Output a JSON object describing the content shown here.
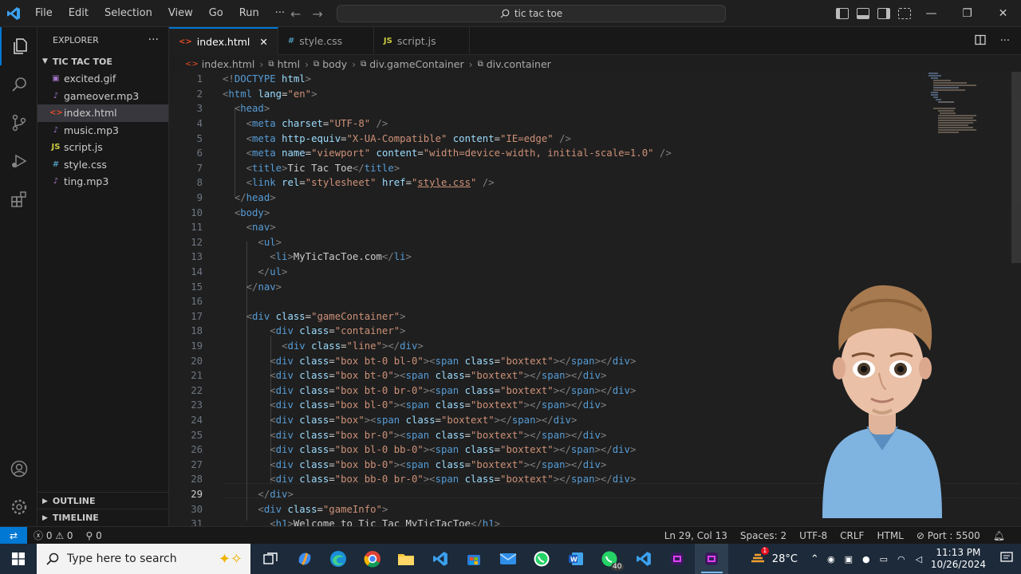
{
  "menu": [
    "File",
    "Edit",
    "Selection",
    "View",
    "Go",
    "Run",
    "···"
  ],
  "search": {
    "text": "tic tac toe"
  },
  "sidebar": {
    "title": "EXPLORER",
    "folder": "TIC TAC TOE",
    "files": [
      {
        "name": "excited.gif",
        "icon": "image-icon",
        "color": "#a074c4"
      },
      {
        "name": "gameover.mp3",
        "icon": "audio-icon",
        "color": "#a074c4"
      },
      {
        "name": "index.html",
        "icon": "html-icon",
        "color": "#e44d26"
      },
      {
        "name": "music.mp3",
        "icon": "audio-icon",
        "color": "#a074c4"
      },
      {
        "name": "script.js",
        "icon": "js-icon",
        "color": "#cbcb41"
      },
      {
        "name": "style.css",
        "icon": "css-icon",
        "color": "#519aba"
      },
      {
        "name": "ting.mp3",
        "icon": "audio-icon",
        "color": "#a074c4"
      }
    ],
    "outline": "OUTLINE",
    "timeline": "TIMELINE"
  },
  "tabs": [
    {
      "label": "index.html",
      "glyph": "<>",
      "color": "#e44d26",
      "active": true
    },
    {
      "label": "style.css",
      "glyph": "#",
      "color": "#519aba",
      "active": false
    },
    {
      "label": "script.js",
      "glyph": "JS",
      "color": "#cbcb41",
      "active": false
    }
  ],
  "breadcrumb": [
    "index.html",
    "html",
    "body",
    "div.gameContainer",
    "div.container"
  ],
  "code": [
    {
      "n": "1",
      "html": "<span class='t'>&lt;!</span><span class='tg'>DOCTYPE</span> <span class='at'>html</span><span class='t'>&gt;</span>"
    },
    {
      "n": "2",
      "html": "<span class='t'>&lt;</span><span class='tg'>html</span> <span class='at'>lang</span><span class='tx'>=</span><span class='st'>\"en\"</span><span class='t'>&gt;</span>"
    },
    {
      "n": "3",
      "html": "  <span class='t'>&lt;</span><span class='tg'>head</span><span class='t'>&gt;</span>"
    },
    {
      "n": "4",
      "html": "    <span class='t'>&lt;</span><span class='tg'>meta</span> <span class='at'>charset</span><span class='tx'>=</span><span class='st'>\"UTF-8\"</span> <span class='t'>/&gt;</span>"
    },
    {
      "n": "5",
      "html": "    <span class='t'>&lt;</span><span class='tg'>meta</span> <span class='at'>http-equiv</span><span class='tx'>=</span><span class='st'>\"X-UA-Compatible\"</span> <span class='at'>content</span><span class='tx'>=</span><span class='st'>\"IE=edge\"</span> <span class='t'>/&gt;</span>"
    },
    {
      "n": "6",
      "html": "    <span class='t'>&lt;</span><span class='tg'>meta</span> <span class='at'>name</span><span class='tx'>=</span><span class='st'>\"viewport\"</span> <span class='at'>content</span><span class='tx'>=</span><span class='st'>\"width=device-width, initial-scale=1.0\"</span> <span class='t'>/&gt;</span>"
    },
    {
      "n": "7",
      "html": "    <span class='t'>&lt;</span><span class='tg'>title</span><span class='t'>&gt;</span><span class='tx'>Tic Tac Toe</span><span class='t'>&lt;/</span><span class='tg'>title</span><span class='t'>&gt;</span>"
    },
    {
      "n": "8",
      "html": "    <span class='t'>&lt;</span><span class='tg'>link</span> <span class='at'>rel</span><span class='tx'>=</span><span class='st'>\"stylesheet\"</span> <span class='at'>href</span><span class='tx'>=</span><span class='st'>\"<u>style.css</u>\"</span> <span class='t'>/&gt;</span>"
    },
    {
      "n": "9",
      "html": "  <span class='t'>&lt;/</span><span class='tg'>head</span><span class='t'>&gt;</span>"
    },
    {
      "n": "10",
      "html": "  <span class='t'>&lt;</span><span class='tg'>body</span><span class='t'>&gt;</span>"
    },
    {
      "n": "11",
      "html": "    <span class='t'>&lt;</span><span class='tg'>nav</span><span class='t'>&gt;</span>"
    },
    {
      "n": "12",
      "html": "      <span class='t'>&lt;</span><span class='tg'>ul</span><span class='t'>&gt;</span>"
    },
    {
      "n": "13",
      "html": "        <span class='t'>&lt;</span><span class='tg'>li</span><span class='t'>&gt;</span><span class='tx'>MyTicTacToe.com</span><span class='t'>&lt;/</span><span class='tg'>li</span><span class='t'>&gt;</span>"
    },
    {
      "n": "14",
      "html": "      <span class='t'>&lt;/</span><span class='tg'>ul</span><span class='t'>&gt;</span>"
    },
    {
      "n": "15",
      "html": "    <span class='t'>&lt;/</span><span class='tg'>nav</span><span class='t'>&gt;</span>"
    },
    {
      "n": "16",
      "html": ""
    },
    {
      "n": "17",
      "html": "    <span class='t'>&lt;</span><span class='tg'>div</span> <span class='at'>class</span><span class='tx'>=</span><span class='st'>\"gameContainer\"</span><span class='t'>&gt;</span>"
    },
    {
      "n": "18",
      "html": "        <span class='t'>&lt;</span><span class='tg'>div</span> <span class='at'>class</span><span class='tx'>=</span><span class='st'>\"container\"</span><span class='t'>&gt;</span>"
    },
    {
      "n": "19",
      "html": "          <span class='t'>&lt;</span><span class='tg'>div</span> <span class='at'>class</span><span class='tx'>=</span><span class='st'>\"line\"</span><span class='t'>&gt;&lt;/</span><span class='tg'>div</span><span class='t'>&gt;</span>"
    },
    {
      "n": "20",
      "html": "        <span class='t'>&lt;</span><span class='tg'>div</span> <span class='at'>class</span><span class='tx'>=</span><span class='st'>\"box bt-0 bl-0\"</span><span class='t'>&gt;&lt;</span><span class='tg'>span</span> <span class='at'>class</span><span class='tx'>=</span><span class='st'>\"boxtext\"</span><span class='t'>&gt;&lt;/</span><span class='tg'>span</span><span class='t'>&gt;&lt;/</span><span class='tg'>div</span><span class='t'>&gt;</span>"
    },
    {
      "n": "21",
      "html": "        <span class='t'>&lt;</span><span class='tg'>div</span> <span class='at'>class</span><span class='tx'>=</span><span class='st'>\"box bt-0\"</span><span class='t'>&gt;&lt;</span><span class='tg'>span</span> <span class='at'>class</span><span class='tx'>=</span><span class='st'>\"boxtext\"</span><span class='t'>&gt;&lt;/</span><span class='tg'>span</span><span class='t'>&gt;&lt;/</span><span class='tg'>div</span><span class='t'>&gt;</span>"
    },
    {
      "n": "22",
      "html": "        <span class='t'>&lt;</span><span class='tg'>div</span> <span class='at'>class</span><span class='tx'>=</span><span class='st'>\"box bt-0 br-0\"</span><span class='t'>&gt;&lt;</span><span class='tg'>span</span> <span class='at'>class</span><span class='tx'>=</span><span class='st'>\"boxtext\"</span><span class='t'>&gt;&lt;/</span><span class='tg'>span</span><span class='t'>&gt;&lt;/</span><span class='tg'>div</span><span class='t'>&gt;</span>"
    },
    {
      "n": "23",
      "html": "        <span class='t'>&lt;</span><span class='tg'>div</span> <span class='at'>class</span><span class='tx'>=</span><span class='st'>\"box bl-0\"</span><span class='t'>&gt;&lt;</span><span class='tg'>span</span> <span class='at'>class</span><span class='tx'>=</span><span class='st'>\"boxtext\"</span><span class='t'>&gt;&lt;/</span><span class='tg'>span</span><span class='t'>&gt;&lt;/</span><span class='tg'>div</span><span class='t'>&gt;</span>"
    },
    {
      "n": "24",
      "html": "        <span class='t'>&lt;</span><span class='tg'>div</span> <span class='at'>class</span><span class='tx'>=</span><span class='st'>\"box\"</span><span class='t'>&gt;&lt;</span><span class='tg'>span</span> <span class='at'>class</span><span class='tx'>=</span><span class='st'>\"boxtext\"</span><span class='t'>&gt;&lt;/</span><span class='tg'>span</span><span class='t'>&gt;&lt;/</span><span class='tg'>div</span><span class='t'>&gt;</span>"
    },
    {
      "n": "25",
      "html": "        <span class='t'>&lt;</span><span class='tg'>div</span> <span class='at'>class</span><span class='tx'>=</span><span class='st'>\"box br-0\"</span><span class='t'>&gt;&lt;</span><span class='tg'>span</span> <span class='at'>class</span><span class='tx'>=</span><span class='st'>\"boxtext\"</span><span class='t'>&gt;&lt;/</span><span class='tg'>span</span><span class='t'>&gt;&lt;/</span><span class='tg'>div</span><span class='t'>&gt;</span>"
    },
    {
      "n": "26",
      "html": "        <span class='t'>&lt;</span><span class='tg'>div</span> <span class='at'>class</span><span class='tx'>=</span><span class='st'>\"box bl-0 bb-0\"</span><span class='t'>&gt;&lt;</span><span class='tg'>span</span> <span class='at'>class</span><span class='tx'>=</span><span class='st'>\"boxtext\"</span><span class='t'>&gt;&lt;/</span><span class='tg'>span</span><span class='t'>&gt;&lt;/</span><span class='tg'>div</span><span class='t'>&gt;</span>"
    },
    {
      "n": "27",
      "html": "        <span class='t'>&lt;</span><span class='tg'>div</span> <span class='at'>class</span><span class='tx'>=</span><span class='st'>\"box bb-0\"</span><span class='t'>&gt;&lt;</span><span class='tg'>span</span> <span class='at'>class</span><span class='tx'>=</span><span class='st'>\"boxtext\"</span><span class='t'>&gt;&lt;/</span><span class='tg'>span</span><span class='t'>&gt;&lt;/</span><span class='tg'>div</span><span class='t'>&gt;</span>"
    },
    {
      "n": "28",
      "html": "        <span class='t'>&lt;</span><span class='tg'>div</span> <span class='at'>class</span><span class='tx'>=</span><span class='st'>\"box bb-0 br-0\"</span><span class='t'>&gt;&lt;</span><span class='tg'>span</span> <span class='at'>class</span><span class='tx'>=</span><span class='st'>\"boxtext\"</span><span class='t'>&gt;&lt;/</span><span class='tg'>span</span><span class='t'>&gt;&lt;/</span><span class='tg'>div</span><span class='t'>&gt;</span>"
    },
    {
      "n": "29",
      "html": "      <span class='t'>&lt;/</span><span class='tg'>div</span><span class='t'>&gt;</span>"
    },
    {
      "n": "30",
      "html": "      <span class='t'>&lt;</span><span class='tg'>div</span> <span class='at'>class</span><span class='tx'>=</span><span class='st'>\"gameInfo\"</span><span class='t'>&gt;</span>"
    },
    {
      "n": "31",
      "html": "        <span class='t'>&lt;</span><span class='tg'>h1</span><span class='t'>&gt;</span><span class='tx'>Welcome to Tic Tac MyTicTacToe</span><span class='t'>&lt;/</span><span class='tg'>h1</span><span class='t'>&gt;</span>"
    }
  ],
  "current_line": "29",
  "status": {
    "errors": "0",
    "warnings": "0",
    "ports_count": "0",
    "position": "Ln 29, Col 13",
    "spaces": "Spaces: 2",
    "encoding": "UTF-8",
    "eol": "CRLF",
    "language": "HTML",
    "port": "Port : 5500"
  },
  "taskbar": {
    "search_placeholder": "Type here to search",
    "weather": "28°C",
    "time": "11:13 PM",
    "date": "10/26/2024",
    "whatsapp_badge": "40",
    "notif_badge": "1"
  }
}
